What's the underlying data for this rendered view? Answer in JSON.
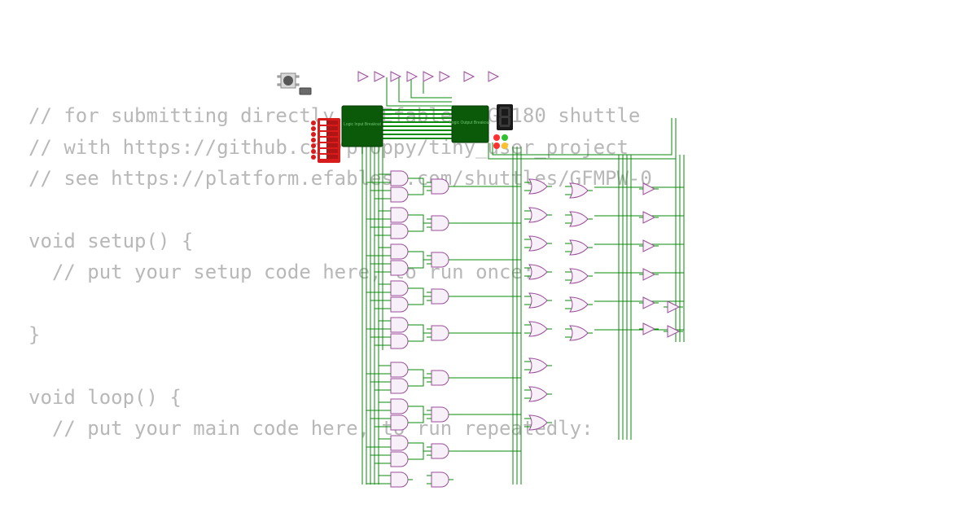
{
  "code": {
    "lines": [
      "// for submitting directly to Efabless GF180 shuttle",
      "// with https://github.com/proppy/tiny_user_project",
      "// see https://platform.efabless.com/shuttles/GFMPW-0",
      "",
      "void setup() {",
      "  // put your setup code here, to run once:",
      "",
      "}",
      "",
      "void loop() {",
      "  // put your main code here, to run repeatedly:"
    ]
  },
  "schematic": {
    "breakout_left_label": "Logic Input Breakout",
    "breakout_right_label": "Logic Output Breakout",
    "gate_rows": 14,
    "gate_columns": 4
  }
}
